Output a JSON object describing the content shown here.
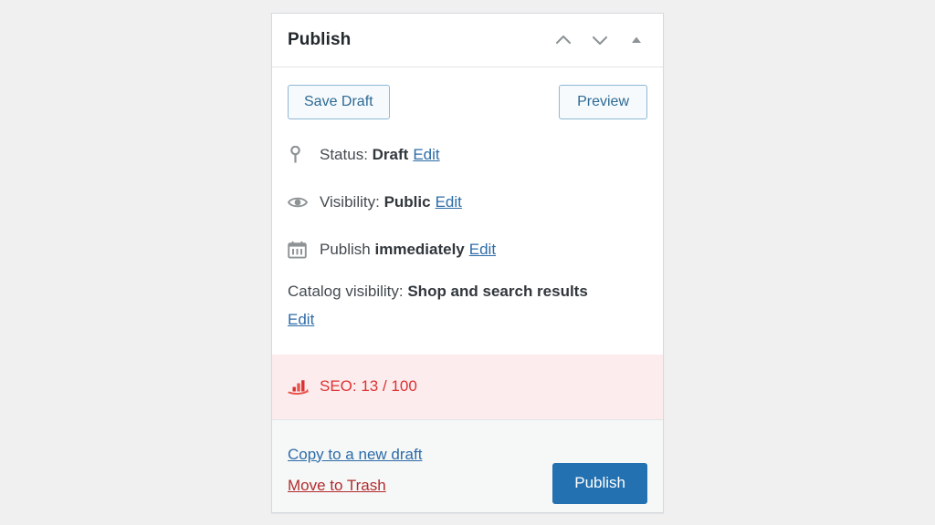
{
  "panel": {
    "title": "Publish",
    "header_actions": [
      {
        "name": "move-up-icon",
        "label": "Move up"
      },
      {
        "name": "move-down-icon",
        "label": "Move down"
      },
      {
        "name": "toggle-panel-icon",
        "label": "Toggle panel"
      }
    ],
    "buttons": {
      "save_draft": "Save Draft",
      "preview": "Preview"
    },
    "misc_rows": [
      {
        "icon": "post-status-icon",
        "label": "Status:",
        "value": "Draft",
        "edit": "Edit"
      },
      {
        "icon": "visibility-eye-icon",
        "label": "Visibility:",
        "value": "Public",
        "edit": "Edit"
      },
      {
        "icon": "calendar-icon",
        "label": "Publish",
        "value": "immediately",
        "edit": "Edit"
      }
    ],
    "catalog": {
      "label": "Catalog visibility:",
      "value": "Shop and search results",
      "edit": "Edit"
    },
    "seo": {
      "icon": "seo-bar-chart-icon",
      "text": "SEO: 13 / 100",
      "score": 13,
      "max": 100,
      "background": "#fdeced",
      "text_color": "#dc3232"
    },
    "footer": {
      "copy_link": "Copy to a new draft",
      "trash_link": "Move to Trash",
      "publish_button": "Publish",
      "publish_color": "#2371b1",
      "trash_color": "#b32d2e"
    }
  }
}
